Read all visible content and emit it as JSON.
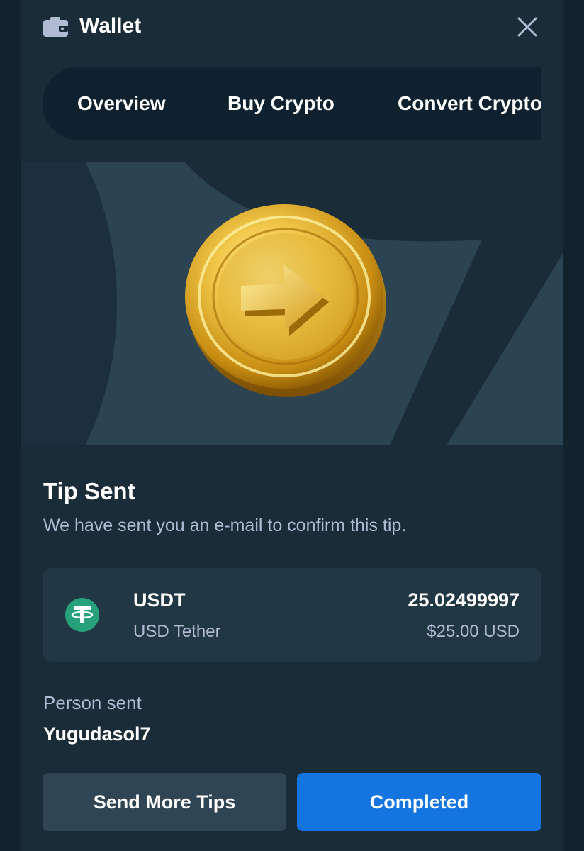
{
  "header": {
    "title": "Wallet",
    "icon": "wallet-icon",
    "close_icon": "close-icon"
  },
  "tabs": [
    {
      "label": "Overview"
    },
    {
      "label": "Buy Crypto"
    },
    {
      "label": "Convert Crypto"
    }
  ],
  "hero": {
    "image": "gold-coin-arrow-icon"
  },
  "tip": {
    "title": "Tip Sent",
    "subtitle": "We have sent you an e-mail to confirm this tip."
  },
  "currency": {
    "code": "USDT",
    "name": "USD Tether",
    "amount": "25.02499997",
    "usd_value": "$25.00 USD",
    "icon": "tether-icon",
    "icon_color": "#26a17b"
  },
  "recipient": {
    "label": "Person sent",
    "name": "Yugudasol7"
  },
  "actions": {
    "send_more_label": "Send More Tips",
    "completed_label": "Completed"
  },
  "colors": {
    "primary": "#1475e1",
    "secondary_button": "#2f4553",
    "panel": "#1a2c38",
    "card": "#213743",
    "muted_text": "#b1bad3"
  }
}
